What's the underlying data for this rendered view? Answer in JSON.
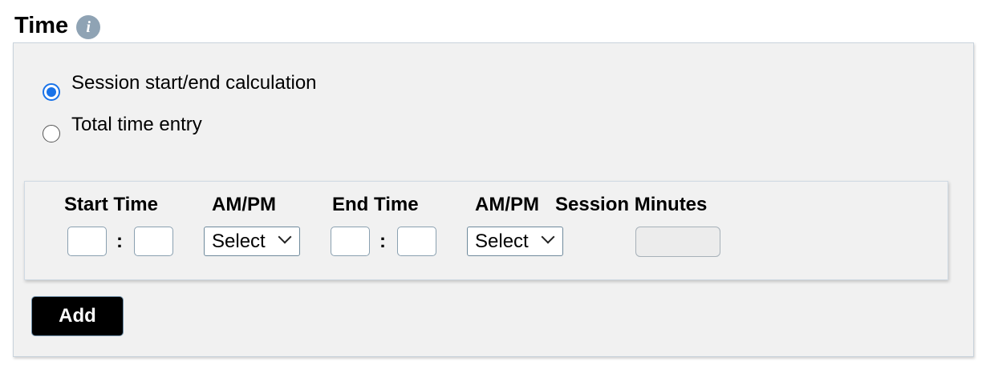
{
  "section": {
    "title": "Time",
    "info_icon": "info-icon"
  },
  "mode": {
    "options": [
      {
        "label": "Session start/end calculation",
        "selected": true
      },
      {
        "label": "Total time entry",
        "selected": false
      }
    ]
  },
  "entry": {
    "headers": {
      "start_time": "Start Time",
      "start_ampm": "AM/PM",
      "end_time": "End Time",
      "end_ampm": "AM/PM",
      "session_minutes": "Session Minutes"
    },
    "start_hour": "",
    "start_minute": "",
    "start_ampm_value": "Select",
    "end_hour": "",
    "end_minute": "",
    "end_ampm_value": "Select",
    "session_minutes_value": "",
    "separator": ":"
  },
  "actions": {
    "add_label": "Add"
  },
  "colors": {
    "accent": "#1a73e8",
    "panel_bg": "#f1f1f1",
    "button_bg": "#000000"
  }
}
